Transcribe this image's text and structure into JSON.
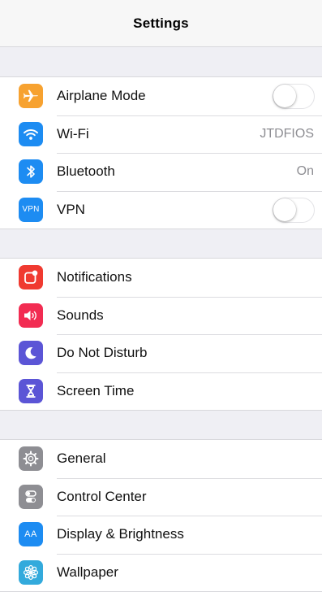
{
  "nav": {
    "title": "Settings"
  },
  "groups": [
    {
      "items": [
        {
          "label": "Airplane Mode",
          "icon": "airplane-icon",
          "color": "#f7a230",
          "control": "toggle",
          "toggle_on": false
        },
        {
          "label": "Wi-Fi",
          "icon": "wifi-icon",
          "color": "#1d8cf2",
          "value": "JTDFIOS"
        },
        {
          "label": "Bluetooth",
          "icon": "bluetooth-icon",
          "color": "#1d8cf2",
          "value": "On"
        },
        {
          "label": "VPN",
          "icon": "vpn-icon",
          "icon_text": "VPN",
          "color": "#1d8cf2",
          "control": "toggle",
          "toggle_on": false
        }
      ]
    },
    {
      "items": [
        {
          "label": "Notifications",
          "icon": "notifications-icon",
          "color": "#f03a30"
        },
        {
          "label": "Sounds",
          "icon": "sounds-icon",
          "color": "#f22c52"
        },
        {
          "label": "Do Not Disturb",
          "icon": "moon-icon",
          "color": "#5b55d6"
        },
        {
          "label": "Screen Time",
          "icon": "hourglass-icon",
          "color": "#5b55d6"
        }
      ]
    },
    {
      "items": [
        {
          "label": "General",
          "icon": "gear-icon",
          "color": "#8e8e93"
        },
        {
          "label": "Control Center",
          "icon": "control-center-icon",
          "color": "#8e8e93"
        },
        {
          "label": "Display & Brightness",
          "icon": "display-brightness-icon",
          "icon_text": "AA",
          "color": "#1d8cf2"
        },
        {
          "label": "Wallpaper",
          "icon": "wallpaper-icon",
          "color": "#33aadc"
        }
      ]
    }
  ]
}
